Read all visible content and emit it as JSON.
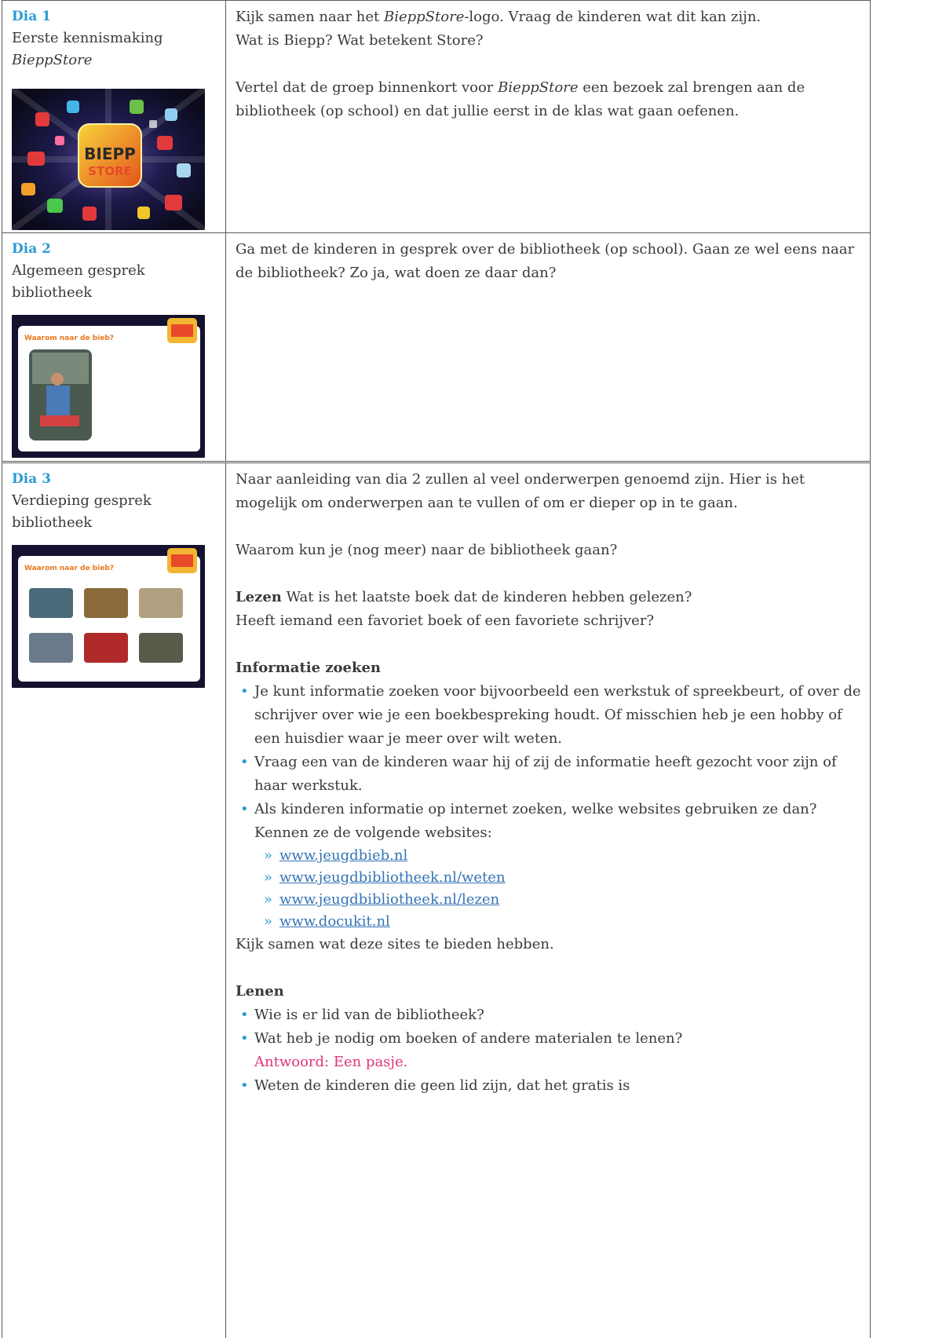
{
  "rows": [
    {
      "dia": "Dia 1",
      "title_line1": "Eerste kennismaking",
      "title_line2": "BieppStore",
      "text1_a": "Kijk samen naar het ",
      "text1_b": "BieppStore",
      "text1_c": "-logo. Vraag de kinderen wat dit kan zijn.",
      "text2": "Wat is Biepp? Wat betekent Store?",
      "text3_a": "Vertel dat de groep binnenkort voor ",
      "text3_b": "BieppStore",
      "text3_c": " een bezoek zal brengen aan de bibliotheek (op school) en dat jullie eerst in de klas wat gaan oefenen.",
      "logo_text_1": "BIEPP",
      "logo_text_2": "STORE"
    },
    {
      "dia": "Dia 2",
      "title_line1": "Algemeen gesprek",
      "title_line2": "bibliotheek",
      "text1": "Ga met de kinderen in gesprek over de bibliotheek (op school). Gaan ze wel eens naar de bibliotheek? Zo ja, wat doen ze daar dan?",
      "slide_title": "Waarom naar de bieb?"
    },
    {
      "dia": "Dia 3",
      "title_line1": "Verdieping gesprek",
      "title_line2": "bibliotheek",
      "slide_title": "Waarom naar de bieb?",
      "intro": "Naar aanleiding van dia 2 zullen al veel onderwerpen genoemd zijn. Hier is het mogelijk om onderwerpen aan te vullen of om er dieper op in te gaan.",
      "question": "Waarom kun je (nog meer) naar de bibliotheek gaan?",
      "lezen_label": "Lezen",
      "lezen_text": " Wat is het laatste boek dat de kinderen hebben gelezen?",
      "lezen_text2": "Heeft iemand een favoriet boek of een favoriete schrijver?",
      "info_heading": "Informatie zoeken",
      "info_bullets": [
        "Je kunt informatie zoeken voor bijvoorbeeld een werkstuk of spreekbeurt, of over de schrijver over wie je een boekbespreking houdt. Of misschien heb je een hobby of een huisdier waar je meer over wilt weten.",
        "Vraag een van de kinderen waar hij of zij de informatie heeft gezocht voor zijn of haar werkstuk.",
        "Als kinderen informatie op internet zoeken, welke websites gebruiken ze dan? Kennen ze de volgende websites:"
      ],
      "links": [
        "www.jeugdbieb.nl",
        "www.jeugdbibliotheek.nl/weten",
        "www.jeugdbibliotheek.nl/lezen",
        "www.docukit.nl"
      ],
      "after_links": "Kijk samen wat deze sites te bieden hebben.",
      "lenen_heading": "Lenen",
      "lenen_bullet1": "Wie is er lid van de bibliotheek?",
      "lenen_bullet2": "Wat heb je nodig om boeken of andere materialen te lenen?",
      "lenen_answer": "Antwoord: Een pasje.",
      "lenen_bullet3": "Weten de kinderen die geen lid zijn, dat het gratis is"
    }
  ],
  "colors": {
    "accent": "#2b9bd3",
    "link": "#3474b5",
    "answer": "#e0357a"
  }
}
